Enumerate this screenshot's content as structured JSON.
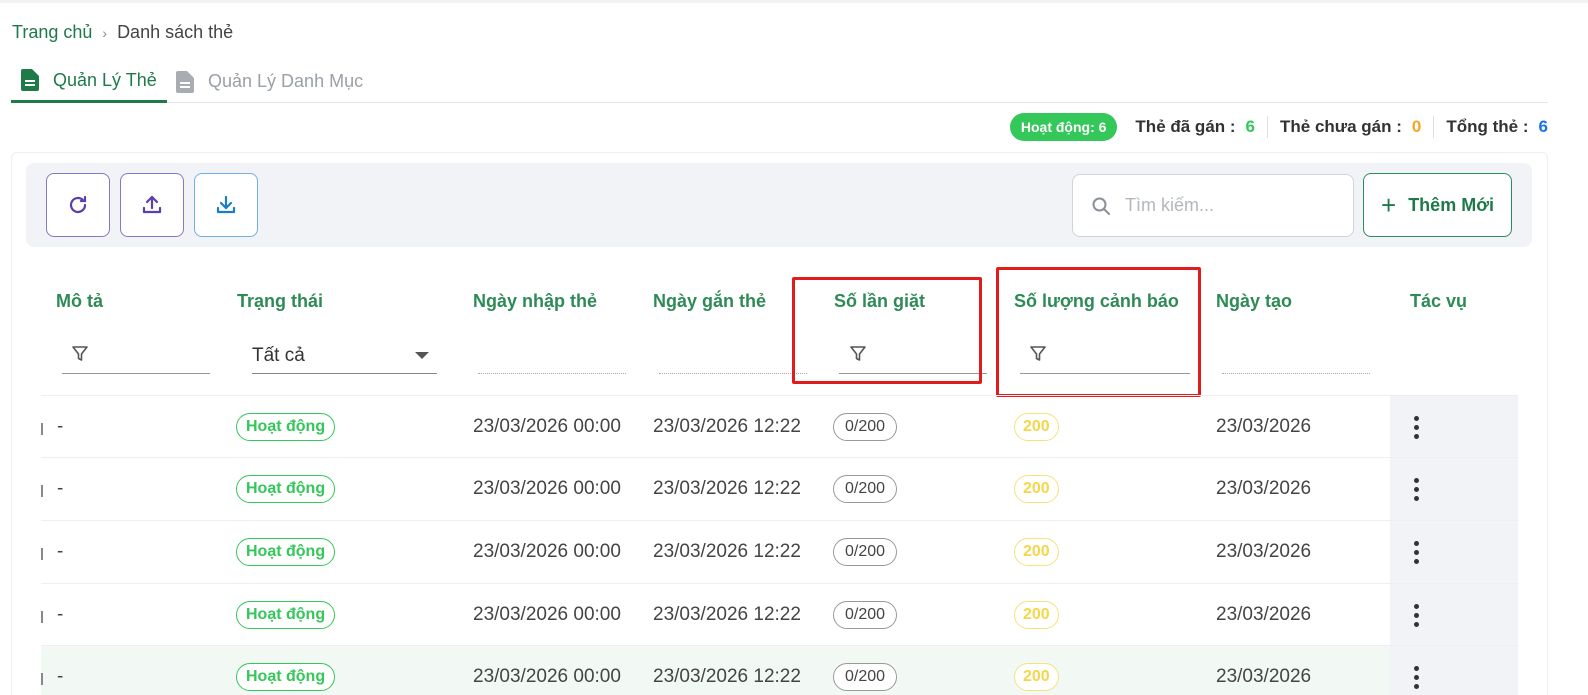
{
  "breadcrumb": {
    "home": "Trang chủ",
    "separator": "›",
    "current": "Danh sách thẻ"
  },
  "tabs": [
    {
      "label": "Quản Lý Thẻ",
      "icon": "document-icon",
      "active": true
    },
    {
      "label": "Quản Lý Danh Mục",
      "icon": "document-icon",
      "active": false
    }
  ],
  "stats": {
    "active_badge": "Hoạt động: 6",
    "assigned_label": "Thẻ đã gán :",
    "assigned_value": "6",
    "unassigned_label": "Thẻ chưa gán :",
    "unassigned_value": "0",
    "total_label": "Tổng thẻ :",
    "total_value": "6"
  },
  "toolbar": {
    "buttons": [
      "refresh-icon",
      "upload-icon",
      "download-icon"
    ],
    "search_placeholder": "Tìm kiếm...",
    "add_label": "Thêm Mới"
  },
  "table": {
    "columns": [
      "Mô tả",
      "Trạng thái",
      "Ngày nhập thẻ",
      "Ngày gắn thẻ",
      "Số lần giặt",
      "Số lượng cảnh báo",
      "Ngày tạo",
      "Tác vụ"
    ],
    "status_filter_value": "Tất cả",
    "rows": [
      {
        "desc": "-",
        "status": "Hoạt động",
        "import_date": "23/03/2026 00:00",
        "attach_date": "23/03/2026 12:22",
        "wash_count": "0/200",
        "warning": "200",
        "created": "23/03/2026"
      },
      {
        "desc": "-",
        "status": "Hoạt động",
        "import_date": "23/03/2026 00:00",
        "attach_date": "23/03/2026 12:22",
        "wash_count": "0/200",
        "warning": "200",
        "created": "23/03/2026"
      },
      {
        "desc": "-",
        "status": "Hoạt động",
        "import_date": "23/03/2026 00:00",
        "attach_date": "23/03/2026 12:22",
        "wash_count": "0/200",
        "warning": "200",
        "created": "23/03/2026"
      },
      {
        "desc": "-",
        "status": "Hoạt động",
        "import_date": "23/03/2026 00:00",
        "attach_date": "23/03/2026 12:22",
        "wash_count": "0/200",
        "warning": "200",
        "created": "23/03/2026"
      },
      {
        "desc": "-",
        "status": "Hoạt động",
        "import_date": "23/03/2026 00:00",
        "attach_date": "23/03/2026 12:22",
        "wash_count": "0/200",
        "warning": "200",
        "created": "23/03/2026"
      }
    ]
  },
  "colors": {
    "primary": "#1f7a4a",
    "header_text": "#2e8b57",
    "active_green": "#34c759",
    "highlight_red": "#e21b1b",
    "warning_yellow": "#f5d64a"
  }
}
